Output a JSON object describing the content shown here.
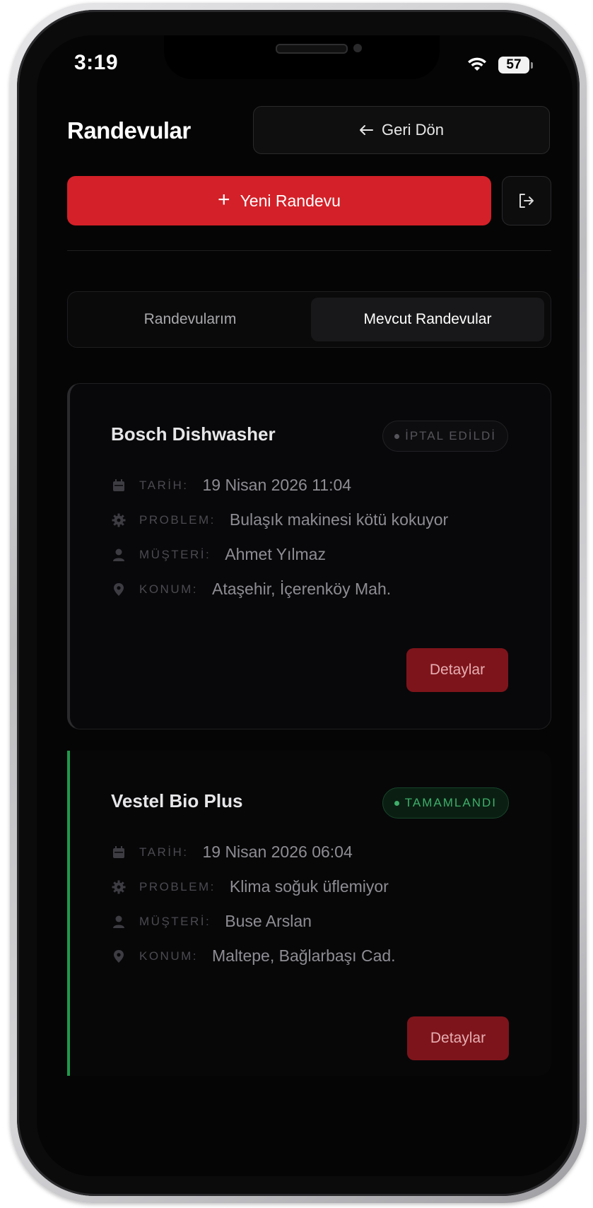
{
  "status_bar": {
    "time": "3:19",
    "battery": "57"
  },
  "header": {
    "title": "Randevular",
    "back_label": "Geri Dön",
    "new_label": "Yeni Randevu"
  },
  "tabs": [
    {
      "label": "Randevularım",
      "active": false
    },
    {
      "label": "Mevcut Randevular",
      "active": true
    }
  ],
  "appointments": [
    {
      "title": "Bosch Dishwasher",
      "status": "İPTAL EDİLDİ",
      "status_color": "#55555b",
      "rows": [
        {
          "icon": "calendar-icon",
          "label": "TARİH:",
          "value": "19 Nisan 2026 11:04"
        },
        {
          "icon": "gear-icon",
          "label": "PROBLEM:",
          "value": "Bulaşık makinesi kötü kokuyor"
        },
        {
          "icon": "user-icon",
          "label": "MÜŞTERİ:",
          "value": "Ahmet Yılmaz"
        },
        {
          "icon": "location-pin-icon",
          "label": "KONUM:",
          "value": "Ataşehir, İçerenköy Mah."
        }
      ],
      "action_label": "Detaylar"
    },
    {
      "title": "Vestel Bio Plus",
      "status": "TAMAMLANDI",
      "status_color": "#3fae6a",
      "rows": [
        {
          "icon": "calendar-icon",
          "label": "TARİH:",
          "value": "19 Nisan 2026 06:04"
        },
        {
          "icon": "gear-icon",
          "label": "PROBLEM:",
          "value": "Klima soğuk üflemiyor"
        },
        {
          "icon": "user-icon",
          "label": "MÜŞTERİ:",
          "value": "Buse Arslan"
        },
        {
          "icon": "location-pin-icon",
          "label": "KONUM:",
          "value": "Maltepe, Bağlarbaşı Cad."
        }
      ],
      "action_label": "Detaylar"
    }
  ],
  "colors": {
    "accent": "#d42028",
    "background": "#050505",
    "success": "#1f9a4a"
  }
}
